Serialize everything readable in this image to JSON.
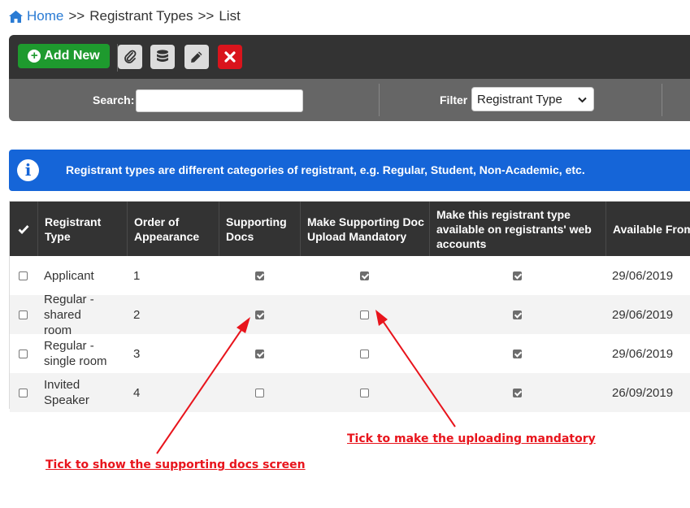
{
  "breadcrumb": {
    "home": "Home",
    "sep1": ">>",
    "section": "Registrant Types",
    "sep2": ">>",
    "page": "List"
  },
  "toolbar": {
    "add_new_label": "Add New",
    "icons": [
      "paperclip-icon",
      "database-icon",
      "pencil-icon",
      "close-icon"
    ]
  },
  "filterbar": {
    "search_label": "Search:",
    "search_value": "",
    "filter_label": "Filter",
    "filter_selected": "Registrant Type"
  },
  "info": {
    "text": "Registrant types are different categories of registrant, e.g. Regular, Student, Non-Academic, etc."
  },
  "table": {
    "headers": [
      "Registrant Type",
      "Order of Appearance",
      "Supporting Docs",
      "Make Supporting Doc Upload Mandatory",
      "Make this registrant type available on registrants' web accounts",
      "Available From"
    ],
    "rows": [
      {
        "type": "Applicant",
        "order": "1",
        "supporting_docs": true,
        "mandatory": true,
        "available_web": true,
        "available_from": "29/06/2019"
      },
      {
        "type": "Regular - shared room",
        "order": "2",
        "supporting_docs": true,
        "mandatory": false,
        "available_web": true,
        "available_from": "29/06/2019"
      },
      {
        "type": "Regular - single room",
        "order": "3",
        "supporting_docs": true,
        "mandatory": false,
        "available_web": true,
        "available_from": "29/06/2019"
      },
      {
        "type": "Invited Speaker",
        "order": "4",
        "supporting_docs": false,
        "mandatory": false,
        "available_web": true,
        "available_from": "26/09/2019"
      }
    ]
  },
  "annotations": {
    "left": "Tick to show the supporting docs screen",
    "right": "Tick to make the uploading mandatory"
  },
  "colors": {
    "accent_blue": "#1565d8",
    "add_green": "#1e9a2e",
    "delete_red": "#d9141c",
    "annotation_red": "#e8141c",
    "header_dark": "#333333"
  }
}
